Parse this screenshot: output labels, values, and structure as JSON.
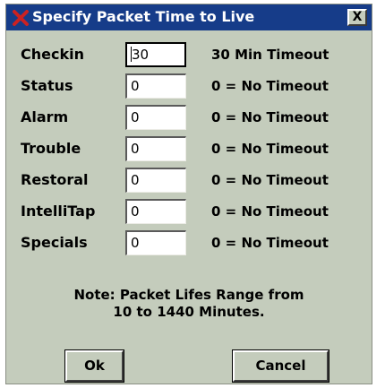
{
  "dialog": {
    "title": "Specify Packet Time to Live",
    "close_label": "X"
  },
  "fields": [
    {
      "label": "Checkin",
      "value": "30",
      "note": "30 Min Timeout"
    },
    {
      "label": "Status",
      "value": "0",
      "note": "0 = No Timeout"
    },
    {
      "label": "Alarm",
      "value": "0",
      "note": "0 = No Timeout"
    },
    {
      "label": "Trouble",
      "value": "0",
      "note": "0 = No Timeout"
    },
    {
      "label": "Restoral",
      "value": "0",
      "note": "0 = No Timeout"
    },
    {
      "label": "IntelliTap",
      "value": "0",
      "note": "0 = No Timeout"
    },
    {
      "label": "Specials",
      "value": "0",
      "note": "0 = No Timeout"
    }
  ],
  "note": {
    "line1": "Note: Packet Lifes Range from",
    "line2": "10 to 1440 Minutes."
  },
  "buttons": {
    "ok_label": "Ok",
    "cancel_label": "Cancel"
  },
  "colors": {
    "titlebar": "#163c89",
    "dialog_background": "#c4ccbc",
    "app_icon": "#cc2222"
  },
  "icons": {
    "app": "red-x-icon"
  }
}
